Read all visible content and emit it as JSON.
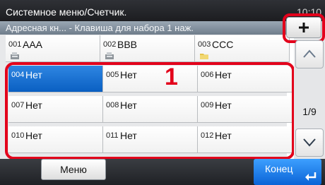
{
  "header": {
    "title": "Системное меню/Счетчик.",
    "clock": "10:10"
  },
  "subheader": {
    "text": "Адресная кн... - Клавиша для набора 1 наж."
  },
  "cells": [
    {
      "num": "001",
      "name": "AAA"
    },
    {
      "num": "002",
      "name": "BBB"
    },
    {
      "num": "003",
      "name": "CCC"
    },
    {
      "num": "004",
      "name": "Нет"
    },
    {
      "num": "005",
      "name": "Нет"
    },
    {
      "num": "006",
      "name": "Нет"
    },
    {
      "num": "007",
      "name": "Нет"
    },
    {
      "num": "008",
      "name": "Нет"
    },
    {
      "num": "009",
      "name": "Нет"
    },
    {
      "num": "010",
      "name": "Нет"
    },
    {
      "num": "011",
      "name": "Нет"
    },
    {
      "num": "012",
      "name": "Нет"
    }
  ],
  "cell_icons": [
    "fax-icon",
    "fax-icon",
    "folder-icon"
  ],
  "selected_cell": "004",
  "annotation": {
    "label": "1"
  },
  "side": {
    "add_icon": "plus-icon",
    "page": "1/9",
    "up_icon": "chevron-up-icon",
    "down_icon": "chevron-down-icon"
  },
  "footer": {
    "menu_label": "Меню",
    "end_label": "Конец",
    "end_icon": "enter-icon"
  },
  "colors": {
    "accent": "#e3001b",
    "selected": "#0a5fc2",
    "end_button": "#1f7ae8"
  }
}
